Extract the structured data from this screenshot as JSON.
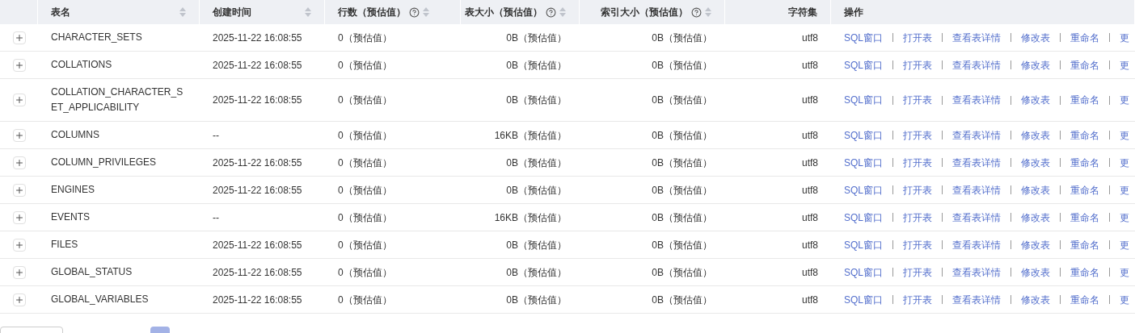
{
  "table": {
    "columns": [
      {
        "label": "表名",
        "sortable": true,
        "help": false
      },
      {
        "label": "创建时间",
        "sortable": true,
        "help": false
      },
      {
        "label": "行数（预估值）",
        "sortable": true,
        "help": true
      },
      {
        "label": "表大小（预估值）",
        "sortable": true,
        "help": true
      },
      {
        "label": "索引大小（预估值）",
        "sortable": true,
        "help": true
      },
      {
        "label": "字符集",
        "sortable": false,
        "help": false
      },
      {
        "label": "操作",
        "sortable": false,
        "help": false
      }
    ],
    "rows": [
      {
        "name": "CHARACTER_SETS",
        "created": "2025-11-22 16:08:55",
        "rows": "0（预估值）",
        "size": "0B（预估值）",
        "index_size": "0B（预估值）",
        "charset": "utf8",
        "actions": [
          "SQL窗口",
          "打开表",
          "查看表详情",
          "修改表",
          "重命名",
          "更"
        ]
      },
      {
        "name": "COLLATIONS",
        "created": "2025-11-22 16:08:55",
        "rows": "0（预估值）",
        "size": "0B（预估值）",
        "index_size": "0B（预估值）",
        "charset": "utf8",
        "actions": [
          "SQL窗口",
          "打开表",
          "查看表详情",
          "修改表",
          "重命名",
          "更"
        ]
      },
      {
        "name": "COLLATION_CHARACTER_SET_APPLICABILITY",
        "created": "2025-11-22 16:08:55",
        "rows": "0（预估值）",
        "size": "0B（预估值）",
        "index_size": "0B（预估值）",
        "charset": "utf8",
        "actions": [
          "SQL窗口",
          "打开表",
          "查看表详情",
          "修改表",
          "重命名",
          "更"
        ]
      },
      {
        "name": "COLUMNS",
        "created": "--",
        "rows": "0（预估值）",
        "size": "16KB（预估值）",
        "index_size": "0B（预估值）",
        "charset": "utf8",
        "actions": [
          "SQL窗口",
          "打开表",
          "查看表详情",
          "修改表",
          "重命名",
          "更"
        ]
      },
      {
        "name": "COLUMN_PRIVILEGES",
        "created": "2025-11-22 16:08:55",
        "rows": "0（预估值）",
        "size": "0B（预估值）",
        "index_size": "0B（预估值）",
        "charset": "utf8",
        "actions": [
          "SQL窗口",
          "打开表",
          "查看表详情",
          "修改表",
          "重命名",
          "更"
        ]
      },
      {
        "name": "ENGINES",
        "created": "2025-11-22 16:08:55",
        "rows": "0（预估值）",
        "size": "0B（预估值）",
        "index_size": "0B（预估值）",
        "charset": "utf8",
        "actions": [
          "SQL窗口",
          "打开表",
          "查看表详情",
          "修改表",
          "重命名",
          "更"
        ]
      },
      {
        "name": "EVENTS",
        "created": "--",
        "rows": "0（预估值）",
        "size": "16KB（预估值）",
        "index_size": "0B（预估值）",
        "charset": "utf8",
        "actions": [
          "SQL窗口",
          "打开表",
          "查看表详情",
          "修改表",
          "重命名",
          "更"
        ]
      },
      {
        "name": "FILES",
        "created": "2025-11-22 16:08:55",
        "rows": "0（预估值）",
        "size": "0B（预估值）",
        "index_size": "0B（预估值）",
        "charset": "utf8",
        "actions": [
          "SQL窗口",
          "打开表",
          "查看表详情",
          "修改表",
          "重命名",
          "更"
        ]
      },
      {
        "name": "GLOBAL_STATUS",
        "created": "2025-11-22 16:08:55",
        "rows": "0（预估值）",
        "size": "0B（预估值）",
        "index_size": "0B（预估值）",
        "charset": "utf8",
        "actions": [
          "SQL窗口",
          "打开表",
          "查看表详情",
          "修改表",
          "重命名",
          "更"
        ]
      },
      {
        "name": "GLOBAL_VARIABLES",
        "created": "2025-11-22 16:08:55",
        "rows": "0（预估值）",
        "size": "0B（预估值）",
        "index_size": "0B（预估值）",
        "charset": "utf8",
        "actions": [
          "SQL窗口",
          "打开表",
          "查看表详情",
          "修改表",
          "重命名",
          "更"
        ]
      }
    ]
  }
}
